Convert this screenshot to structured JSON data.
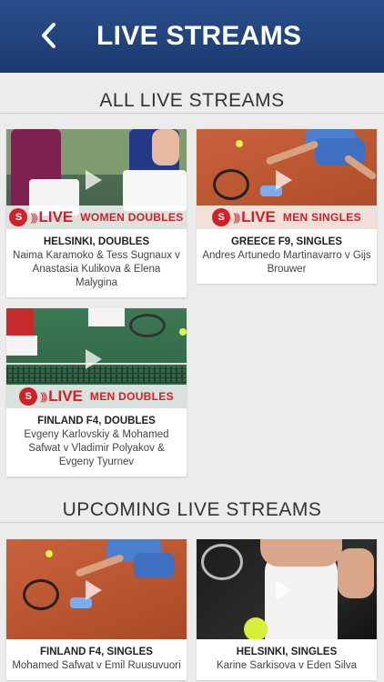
{
  "header": {
    "title": "LIVE STREAMS",
    "back_icon": "chevron-left-icon"
  },
  "sections": {
    "all": "ALL LIVE STREAMS",
    "upcoming": "UPCOMING LIVE STREAMS"
  },
  "live_label": "LIVE",
  "live_logo_text": "S",
  "colors": {
    "header": "#1f4178",
    "live_red": "#d32026"
  },
  "live_streams": [
    {
      "title": "HELSINKI, DOUBLES",
      "players": "Naima Karamoko & Tess Sugnaux v Anastasia Kulikova & Elena Malygina",
      "badge": "WOMEN DOUBLES"
    },
    {
      "title": "GREECE F9, SINGLES",
      "players": "Andres Artunedo Martinavarro v Gijs Brouwer",
      "badge": "MEN SINGLES"
    },
    {
      "title": "FINLAND F4, DOUBLES",
      "players": "Evgeny Karlovskiy & Mohamed Safwat v Vladimir Polyakov & Evgeny Tyurnev",
      "badge": "MEN DOUBLES"
    }
  ],
  "upcoming_streams": [
    {
      "title": "FINLAND F4, SINGLES",
      "players": "Mohamed Safwat v Emil Ruusuvuori"
    },
    {
      "title": "HELSINKI, SINGLES",
      "players": "Karine Sarkisova v Eden Silva"
    }
  ]
}
